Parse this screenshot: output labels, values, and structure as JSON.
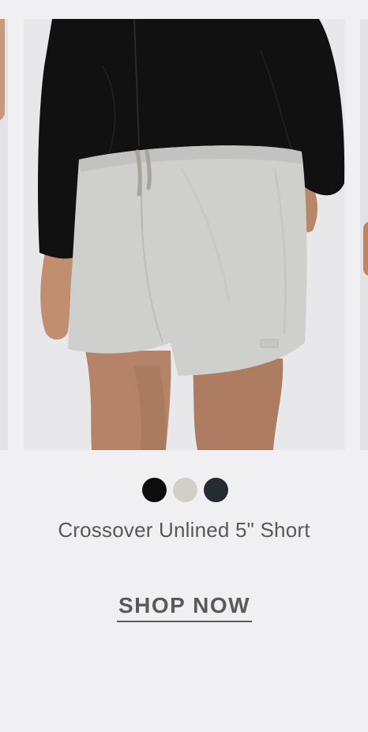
{
  "product": {
    "name": "Crossover Unlined 5\" Short",
    "image_alt": "Model wearing light grey crossover unlined 5 inch shorts with black jacket",
    "cta_label": "SHOP NOW"
  },
  "swatches": [
    {
      "name": "black",
      "color": "#0d0d0d"
    },
    {
      "name": "stone",
      "color": "#d3cfc6"
    },
    {
      "name": "charcoal",
      "color": "#252c31"
    }
  ],
  "colors": {
    "background": "#f0f0f2",
    "text": "#58585c",
    "shorts": "#cfcfcd",
    "jacket": "#111111"
  }
}
